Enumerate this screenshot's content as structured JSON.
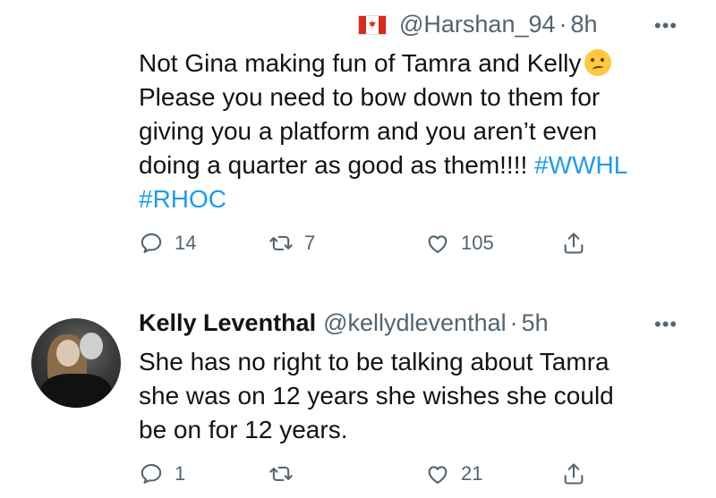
{
  "tweets": [
    {
      "display_name": "",
      "handle": "@Harshan_94",
      "separator": "·",
      "time": "8h",
      "flag_icon": "canada-flag-icon",
      "more_label": "•••",
      "lines": [
        "Not Gina making fun of Tamra and Kelly",
        "Please you need to bow down to them for",
        "giving you a platform and you aren’t even",
        "doing a quarter as good as them!!!! "
      ],
      "hashtags": [
        "#WWHL",
        "#RHOC"
      ],
      "emoji_icon": "woozy-face-emoji",
      "reply_count": "14",
      "retweet_count": "7",
      "like_count": "105"
    },
    {
      "display_name": "Kelly Leventhal",
      "handle": "@kellydleventhal",
      "separator": "·",
      "time": "5h",
      "more_label": "•••",
      "lines": [
        "She has no right to be talking about Tamra",
        "she was on 12 years she wishes she could",
        "be on for 12 years."
      ],
      "reply_count": "1",
      "retweet_count": "",
      "like_count": "21"
    }
  ],
  "icons": {
    "reply": "reply-icon",
    "retweet": "retweet-icon",
    "like": "like-icon",
    "share": "share-icon"
  }
}
